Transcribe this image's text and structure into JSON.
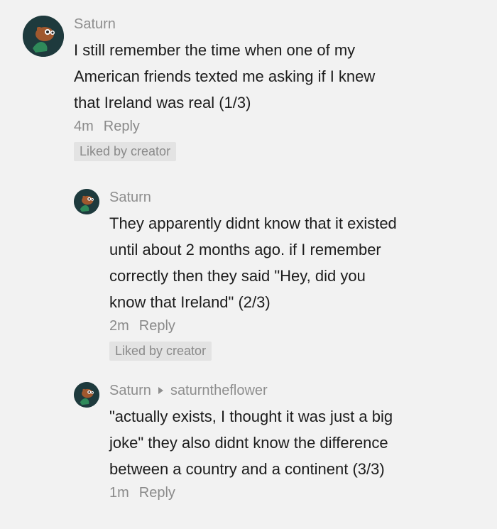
{
  "comments": [
    {
      "username": "Saturn",
      "text": "I still remember the time when one of my\nAmerican friends texted me asking if I knew\nthat Ireland was real (1/3)",
      "time": "4m",
      "reply_label": "Reply",
      "liked_badge": "Liked by creator"
    },
    {
      "username": "Saturn",
      "text": "They apparently didnt know that it existed\nuntil about 2 months ago. if I remember\ncorrectly then they said \"Hey, did you\nknow that Ireland\" (2/3)",
      "time": "2m",
      "reply_label": "Reply",
      "liked_badge": "Liked by creator"
    },
    {
      "username": "Saturn",
      "reply_to": "saturntheflower",
      "text": "\"actually exists, I thought it was just a big\njoke\" they also didnt know the difference\nbetween a country and a continent (3/3)",
      "time": "1m",
      "reply_label": "Reply"
    }
  ],
  "avatar_icon": "cartoon-character-icon"
}
